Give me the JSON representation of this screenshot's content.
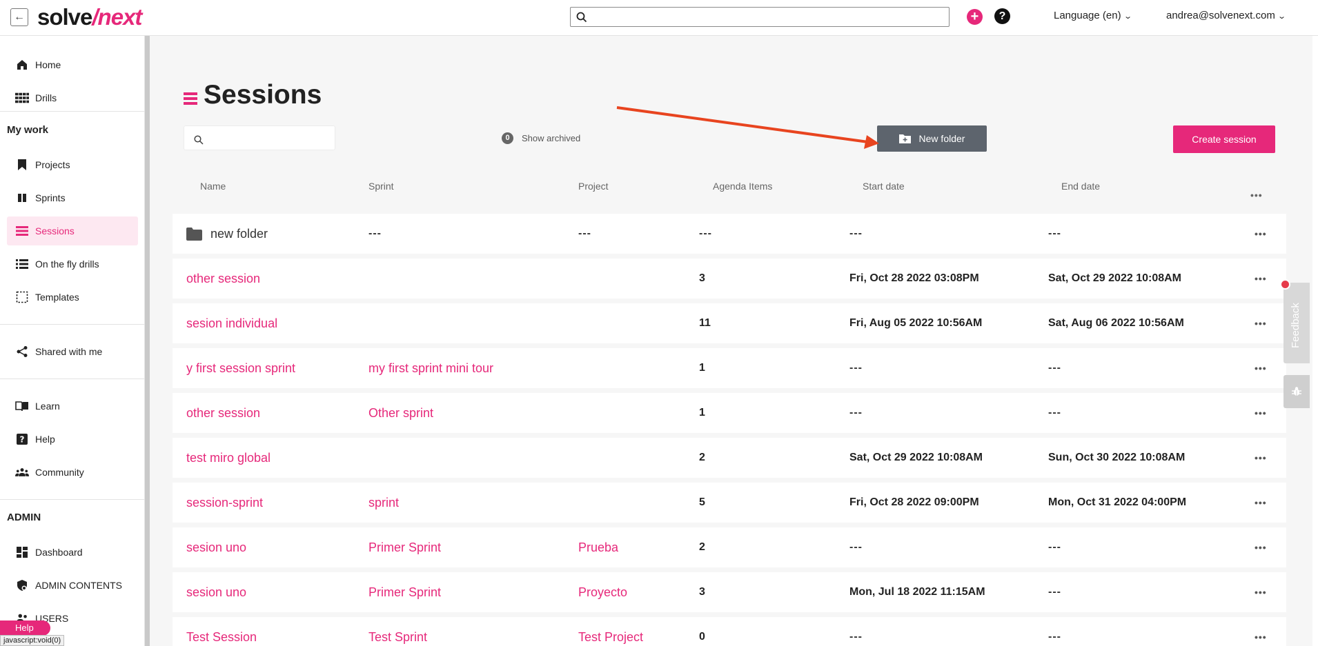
{
  "app": {
    "logo_solve": "solve",
    "logo_next": "/next"
  },
  "topbar": {
    "search_placeholder": "",
    "language": "Language (en)",
    "user": "andrea@solvenext.com"
  },
  "sidebar": {
    "top_items": [
      {
        "label": "Home",
        "icon": "home-icon"
      },
      {
        "label": "Drills",
        "icon": "grid-icon"
      }
    ],
    "my_work_title": "My work",
    "my_work_items": [
      {
        "label": "Projects",
        "icon": "bookmark-icon"
      },
      {
        "label": "Sprints",
        "icon": "sprint-icon"
      },
      {
        "label": "Sessions",
        "icon": "sessions-icon"
      },
      {
        "label": "On the fly drills",
        "icon": "list-icon"
      },
      {
        "label": "Templates",
        "icon": "template-icon"
      }
    ],
    "shared_label": "Shared with me",
    "help_items": [
      {
        "label": "Learn",
        "icon": "book-icon"
      },
      {
        "label": "Help",
        "icon": "question-icon"
      },
      {
        "label": "Community",
        "icon": "people-icon"
      }
    ],
    "admin_title": "ADMIN",
    "admin_items": [
      {
        "label": "Dashboard",
        "icon": "dashboard-icon"
      },
      {
        "label": "ADMIN CONTENTS",
        "icon": "admin-shield-icon"
      },
      {
        "label": "USERS",
        "icon": "users-icon"
      }
    ],
    "help_pill": "Help",
    "status_url": "javascript:void(0)"
  },
  "main": {
    "title": "Sessions",
    "search_placeholder": "",
    "archived_count": "0",
    "archived_label": "Show archived",
    "new_folder_label": "New folder",
    "create_label": "Create session",
    "columns": [
      "Name",
      "Sprint",
      "Project",
      "Agenda Items",
      "Start date",
      "End date"
    ],
    "more": "•••",
    "rows": [
      {
        "name": "new folder",
        "folder": true,
        "sprint": "---",
        "project": "---",
        "agenda": "---",
        "start": "---",
        "end": "---"
      },
      {
        "name": "other session",
        "sprint": "",
        "project": "",
        "agenda": "3",
        "start": "Fri, Oct 28 2022 03:08PM",
        "end": "Sat, Oct 29 2022 10:08AM"
      },
      {
        "name": "sesion individual",
        "sprint": "",
        "project": "",
        "agenda": "11",
        "start": "Fri, Aug 05 2022 10:56AM",
        "end": "Sat, Aug 06 2022 10:56AM"
      },
      {
        "name": "y first session sprint",
        "sprint": "my first sprint mini tour",
        "project": "",
        "agenda": "1",
        "start": "---",
        "end": "---"
      },
      {
        "name": "other session",
        "sprint": "Other sprint",
        "project": "",
        "agenda": "1",
        "start": "---",
        "end": "---"
      },
      {
        "name": "test miro global",
        "sprint": "",
        "project": "",
        "agenda": "2",
        "start": "Sat, Oct 29 2022 10:08AM",
        "end": "Sun, Oct 30 2022 10:08AM"
      },
      {
        "name": "session-sprint",
        "sprint": "sprint",
        "project": "",
        "agenda": "5",
        "start": "Fri, Oct 28 2022 09:00PM",
        "end": "Mon, Oct 31 2022 04:00PM"
      },
      {
        "name": "sesion uno",
        "sprint": "Primer Sprint",
        "project": "Prueba",
        "agenda": "2",
        "start": "---",
        "end": "---"
      },
      {
        "name": "sesion uno",
        "sprint": "Primer Sprint",
        "project": "Proyecto",
        "agenda": "3",
        "start": "Mon, Jul 18 2022 11:15AM",
        "end": "---"
      },
      {
        "name": "Test Session",
        "sprint": "Test Sprint",
        "project": "Test Project",
        "agenda": "0",
        "start": "---",
        "end": "---"
      }
    ]
  },
  "feedback": {
    "label": "Feedback"
  },
  "colors": {
    "accent": "#e6287a",
    "button_gray": "#5d646d",
    "arrow": "#e8441f"
  }
}
